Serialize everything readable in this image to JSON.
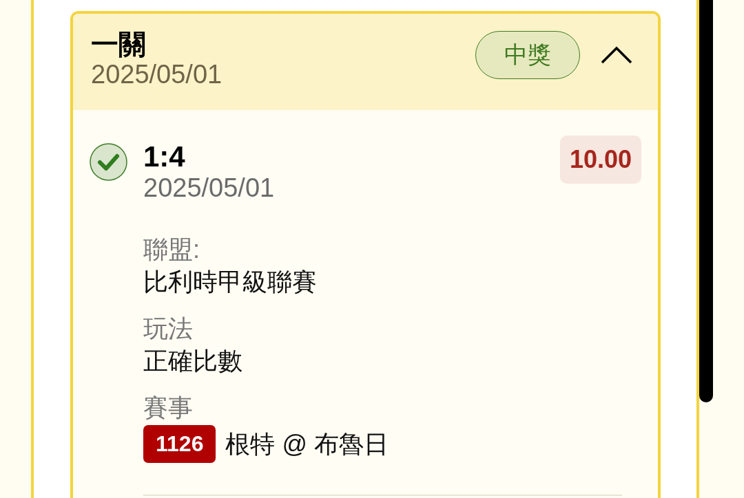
{
  "bet": {
    "title": "一關",
    "date": "2025/05/01",
    "status": {
      "kind": "won",
      "label": "中獎"
    },
    "expanded": true,
    "selections": [
      {
        "won": true,
        "score": "1:4",
        "date": "2025/05/01",
        "odds": "10.00",
        "fields": [
          {
            "kind": "text",
            "label": "聯盟:",
            "value": "比利時甲級聯賽"
          },
          {
            "kind": "text",
            "label": "玩法",
            "value": "正確比數"
          },
          {
            "kind": "match",
            "label": "賽事",
            "match_number": "1126",
            "value": "根特 @ 布魯日"
          }
        ]
      }
    ]
  }
}
